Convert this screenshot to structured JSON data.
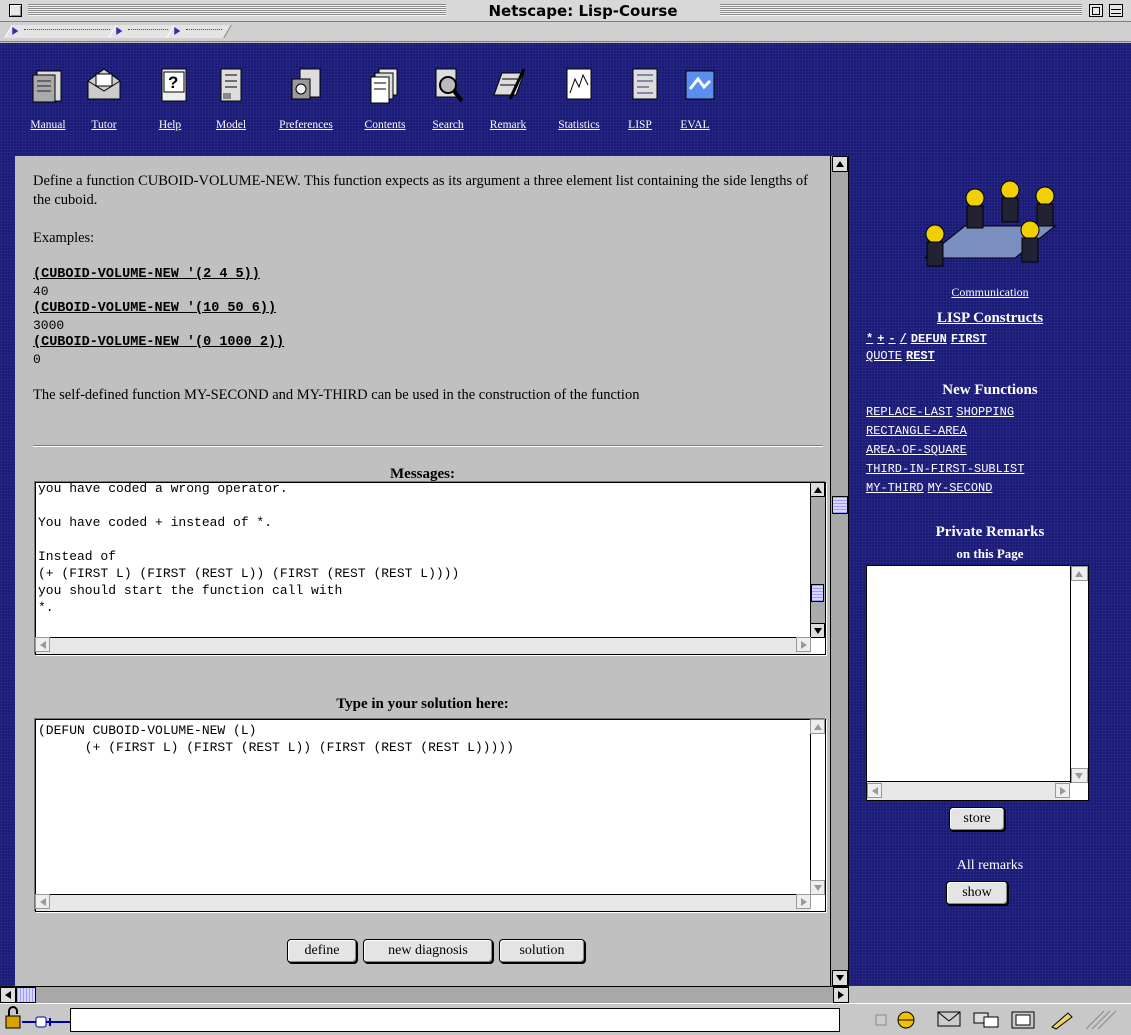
{
  "window": {
    "title": "Netscape: Lisp-Course"
  },
  "nav": [
    {
      "label": "Manual",
      "icon": "manual-icon"
    },
    {
      "label": "Tutor",
      "icon": "tutor-icon"
    },
    {
      "label": "Help",
      "icon": "help-icon"
    },
    {
      "label": "Model",
      "icon": "model-icon"
    },
    {
      "label": "Preferences",
      "icon": "preferences-icon"
    },
    {
      "label": "Contents",
      "icon": "contents-icon"
    },
    {
      "label": "Search",
      "icon": "search-icon"
    },
    {
      "label": "Remark",
      "icon": "remark-icon"
    },
    {
      "label": "Statistics",
      "icon": "statistics-icon"
    },
    {
      "label": "LISP",
      "icon": "lisp-icon"
    },
    {
      "label": "EVAL",
      "icon": "eval-icon"
    }
  ],
  "task": {
    "description": "Define a function CUBOID-VOLUME-NEW. This function expects as its argument a three element list containing the side lengths of the cuboid.",
    "examples_label": "Examples:",
    "examples": [
      {
        "call": "(CUBOID-VOLUME-NEW '(2 4 5))",
        "result": "40"
      },
      {
        "call": "(CUBOID-VOLUME-NEW '(10 50 6))",
        "result": "3000"
      },
      {
        "call": "(CUBOID-VOLUME-NEW '(0 1000 2))",
        "result": "0"
      }
    ],
    "note": "The self-defined function MY-SECOND and MY-THIRD can be used in the construction of the function"
  },
  "messages": {
    "label": "Messages:",
    "text": "you have coded a wrong operator.\n\nYou have coded + instead of *.\n\nInstead of\n(+ (FIRST L) (FIRST (REST L)) (FIRST (REST (REST L))))\nyou should start the function call with\n*."
  },
  "solution": {
    "label": "Type in your solution here:",
    "text": "(DEFUN CUBOID-VOLUME-NEW (L)\n      (+ (FIRST L) (FIRST (REST L)) (FIRST (REST (REST L)))))"
  },
  "buttons": {
    "define": "define",
    "diagnosis": "new diagnosis",
    "solution": "solution"
  },
  "sidebar": {
    "communication": "Communication",
    "lisp_constructs_title": "LISP Constructs",
    "lisp_constructs": [
      "*",
      "+",
      "-",
      "/",
      "DEFUN",
      "FIRST",
      "QUOTE",
      "REST"
    ],
    "new_functions_title": "New Functions",
    "new_functions": [
      "REPLACE-LAST",
      "SHOPPING",
      "RECTANGLE-AREA",
      "AREA-OF-SQUARE",
      "THIRD-IN-FIRST-SUBLIST",
      "MY-THIRD",
      "MY-SECOND"
    ],
    "remarks_title": "Private Remarks",
    "remarks_subtitle": "on this Page",
    "remarks_text": "",
    "store_label": "store",
    "all_remarks_label": "All remarks",
    "show_label": "show"
  },
  "colors": {
    "navy": "#1a1a78",
    "link": "#ffffff"
  }
}
